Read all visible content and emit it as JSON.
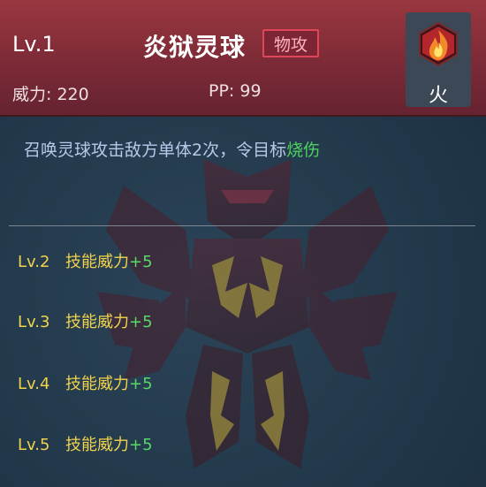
{
  "skill": {
    "level": "Lv.1",
    "name": "炎狱灵球",
    "category": "物攻",
    "power_label": "威力:",
    "power_value": "220",
    "pp_label": "PP:",
    "pp_value": "99",
    "element_label": "火",
    "element_icon": "fire-element-icon",
    "description_main": "召唤灵球攻击敌方单体2次，令目标",
    "description_effect": "烧伤"
  },
  "upgrades": [
    {
      "level": "Lv.2",
      "effect": "技能威力",
      "bonus": "+5"
    },
    {
      "level": "Lv.3",
      "effect": "技能威力",
      "bonus": "+5"
    },
    {
      "level": "Lv.4",
      "effect": "技能威力",
      "bonus": "+5"
    },
    {
      "level": "Lv.5",
      "effect": "技能威力",
      "bonus": "+5"
    }
  ],
  "colors": {
    "header": "#7c2a37",
    "tag_border": "#e0465a",
    "level_text": "#f0d24c",
    "bonus_text": "#58d866",
    "effect_text": "#4ed45f"
  }
}
